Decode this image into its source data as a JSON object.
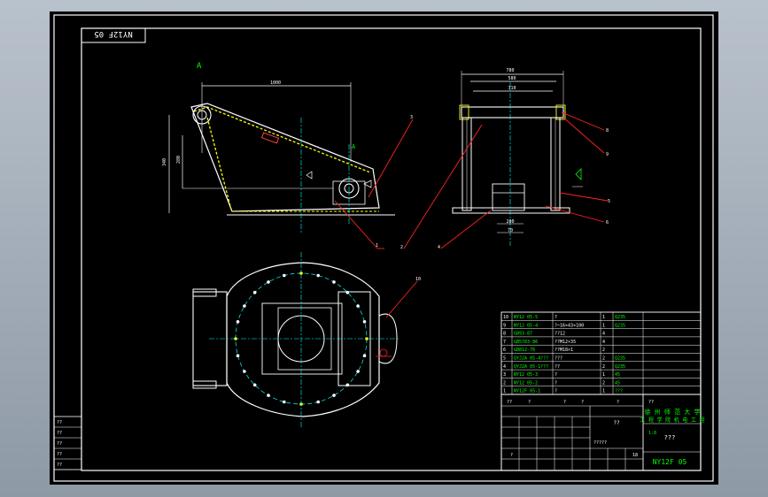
{
  "sheet": {
    "rotated_code": "NY12F 05",
    "drawing_number": "NY12F 05",
    "company_line1": "徐 州 师 范 大 学",
    "company_line2": "工 程 学 院  机 电 工 程",
    "part_name": "???",
    "center_mark": "??",
    "scale_mark": "1:8",
    "sheet_count": "18",
    "misc_marks": [
      "??",
      "?",
      "?",
      "?",
      "?",
      "?????",
      "??",
      "?"
    ]
  },
  "views": {
    "front_view_label": "A",
    "section_label": "A",
    "top_dims": [
      "1000",
      "780",
      "580",
      "310"
    ],
    "side_dims": [
      "340",
      "280",
      "200",
      "70"
    ],
    "leaders": [
      "1",
      "2",
      "3",
      "4",
      "5",
      "6",
      "7",
      "8",
      "9",
      "10"
    ]
  },
  "bom": {
    "rows": [
      {
        "no": "10",
        "code": "NY12 05-5",
        "name": "?",
        "qty": "1",
        "mat": "Q235"
      },
      {
        "no": "9",
        "code": "NY12 05-4",
        "name": "?~16×43×100",
        "qty": "1",
        "mat": "Q235"
      },
      {
        "no": "8",
        "code": "GB93-87",
        "name": "??12",
        "qty": "4",
        "mat": ""
      },
      {
        "no": "7",
        "code": "GB5783-86",
        "name": "??M12×35",
        "qty": "4",
        "mat": ""
      },
      {
        "no": "6",
        "code": "GB812-76",
        "name": "??M18×1",
        "qty": "2",
        "mat": ""
      },
      {
        "no": "5",
        "code": "QYJ2A 05-4???",
        "name": "???",
        "qty": "2",
        "mat": "Q235"
      },
      {
        "no": "4",
        "code": "QYJ2A 05-1???",
        "name": "??",
        "qty": "2",
        "mat": "Q235"
      },
      {
        "no": "3",
        "code": "NY12 05-3",
        "name": "?",
        "qty": "1",
        "mat": "45"
      },
      {
        "no": "2",
        "code": "NY12 05-2",
        "name": "?",
        "qty": "2",
        "mat": "45"
      },
      {
        "no": "1",
        "code": "NY12F 05-1",
        "name": "?",
        "qty": "1",
        "mat": "???"
      }
    ]
  },
  "left_notes": [
    "??",
    "??",
    "??",
    "??",
    "??"
  ]
}
